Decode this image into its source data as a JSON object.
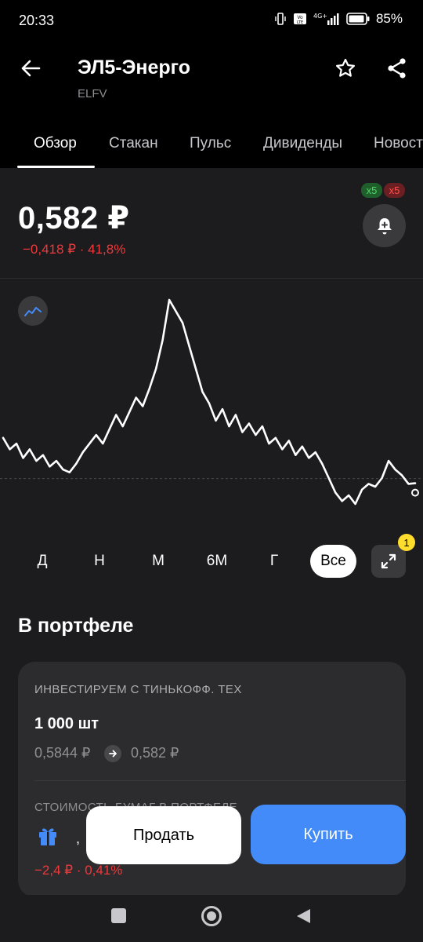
{
  "status_bar": {
    "time": "20:33",
    "battery": "85%",
    "network": "4G+",
    "volte": "Vo LTE"
  },
  "header": {
    "title": "ЭЛ5-Энерго",
    "ticker": "ELFV"
  },
  "tabs": [
    {
      "label": "Обзор",
      "active": true
    },
    {
      "label": "Стакан",
      "active": false
    },
    {
      "label": "Пульс",
      "active": false
    },
    {
      "label": "Дивиденды",
      "active": false
    },
    {
      "label": "Новости",
      "active": false
    }
  ],
  "quote": {
    "price": "0,582 ₽",
    "change": "−0,418 ₽ · 41,8%"
  },
  "alerts": {
    "badge_green": "x5",
    "badge_red": "x5"
  },
  "chart_data": {
    "type": "line",
    "series": [
      {
        "values": [
          0.74,
          0.7,
          0.72,
          0.67,
          0.7,
          0.66,
          0.68,
          0.64,
          0.66,
          0.63,
          0.62,
          0.65,
          0.69,
          0.72,
          0.75,
          0.72,
          0.77,
          0.82,
          0.78,
          0.83,
          0.88,
          0.85,
          0.91,
          0.98,
          1.08,
          1.22,
          1.18,
          1.14,
          1.06,
          0.98,
          0.9,
          0.86,
          0.8,
          0.84,
          0.78,
          0.82,
          0.76,
          0.79,
          0.75,
          0.78,
          0.72,
          0.74,
          0.7,
          0.73,
          0.68,
          0.71,
          0.67,
          0.69,
          0.65,
          0.6,
          0.55,
          0.52,
          0.54,
          0.51,
          0.56,
          0.58,
          0.57,
          0.6,
          0.66,
          0.63,
          0.61,
          0.58,
          0.582
        ]
      }
    ],
    "reference_line": "dashed",
    "grid": false
  },
  "periods": [
    {
      "label": "Д",
      "active": false
    },
    {
      "label": "Н",
      "active": false
    },
    {
      "label": "М",
      "active": false
    },
    {
      "label": "6М",
      "active": false
    },
    {
      "label": "Г",
      "active": false
    },
    {
      "label": "Все",
      "active": true
    }
  ],
  "expand_badge": "1",
  "portfolio": {
    "section_title": "В портфеле",
    "account": "ИНВЕСТИРУЕМ С ТИНЬКОФФ. TEX",
    "quantity": "1 000 шт",
    "avg_price": "0,5844 ₽",
    "current_price": "0,582 ₽",
    "value_label": "СТОИМОСТЬ БУМАГ В ПОРТФЕЛЕ",
    "value_change": "−2,4 ₽ · 0,41%",
    "stray_char": ","
  },
  "actions": {
    "sell": "Продать",
    "buy": "Купить"
  },
  "colors": {
    "accent": "#428bf9",
    "negative": "#f0383b",
    "positive": "#4cd964",
    "badge_yellow": "#ffdd2d"
  }
}
